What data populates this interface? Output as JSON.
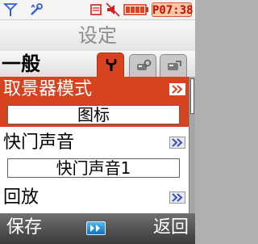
{
  "status_bar": {
    "time": "P07:38",
    "icons": [
      "signal-icon",
      "tool-icon",
      "message-icon",
      "mute-icon",
      "battery-icon"
    ]
  },
  "header": {
    "title": "设定"
  },
  "tabs": {
    "title": "一般",
    "items": [
      {
        "icon": "wrench-icon",
        "active": true
      },
      {
        "icon": "phone-settings-icon",
        "active": false
      },
      {
        "icon": "network-settings-icon",
        "active": false
      }
    ]
  },
  "list": {
    "items": [
      {
        "label": "取景器模式",
        "value": "图标",
        "selected": true
      },
      {
        "label": "快门声音",
        "value": "快门声音1",
        "selected": false
      },
      {
        "label": "回放",
        "selected": false
      }
    ],
    "scroll_position": 0.0
  },
  "softkeys": {
    "left": "保存",
    "center_icon": "forward-icon",
    "right": "返回"
  },
  "colors": {
    "accent": "#d8431f",
    "softkey_bg": "#4a4a4a",
    "time_text": "#c01000"
  }
}
